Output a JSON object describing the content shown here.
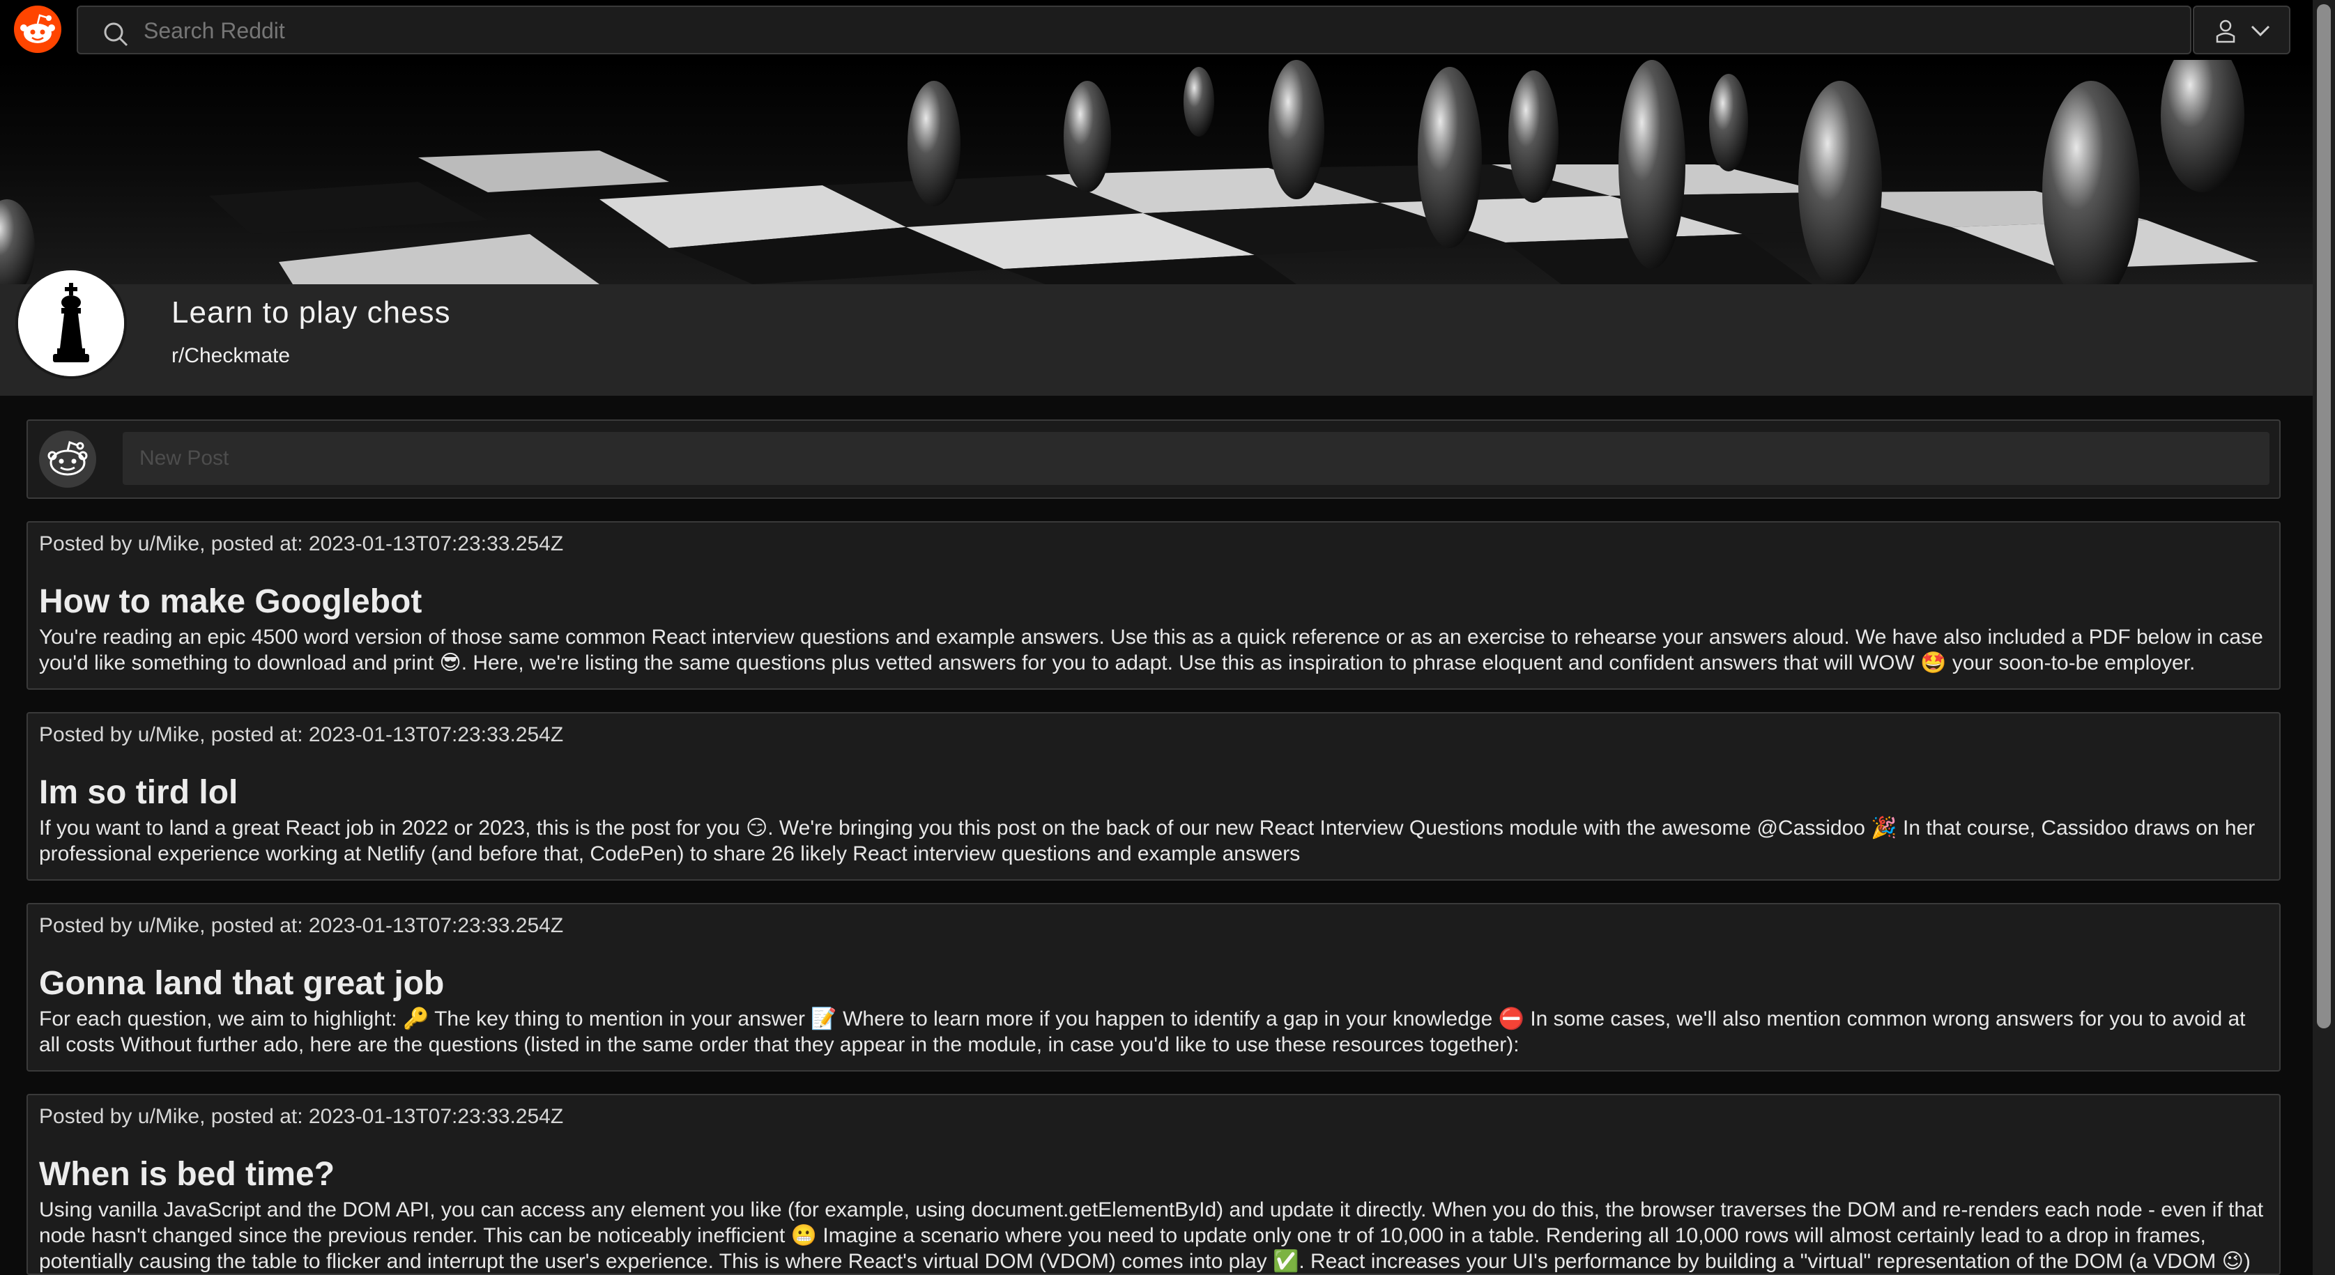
{
  "search": {
    "placeholder": "Search Reddit"
  },
  "icons": {
    "logo": "reddit-logo-icon",
    "search": "search-icon",
    "user": "user-icon",
    "chevron": "chevron-down-icon",
    "avatar": "chess-king-icon",
    "create_avatar": "reddit-snoo-icon"
  },
  "colors": {
    "brand": "#ff4500",
    "background": "#0b0b0b",
    "card": "#1c1c1c"
  },
  "community": {
    "title": "Learn to play chess",
    "name": "r/Checkmate"
  },
  "create_post": {
    "placeholder": "New Post"
  },
  "posts": [
    {
      "meta": "Posted by u/Mike, posted at: 2023-01-13T07:23:33.254Z",
      "title": "How to make Googlebot",
      "body": "You're reading an epic 4500 word version of those same common React interview questions and example answers. Use this as a quick reference or as an exercise to rehearse your answers aloud. We have also included a PDF below in case you'd like something to download and print 😎. Here, we're listing the same questions plus vetted answers for you to adapt. Use this as inspiration to phrase eloquent and confident answers that will WOW 🤩 your soon-to-be employer."
    },
    {
      "meta": "Posted by u/Mike, posted at: 2023-01-13T07:23:33.254Z",
      "title": "Im so tird lol",
      "body": "If you want to land a great React job in 2022 or 2023, this is the post for you 😏. We're bringing you this post on the back of our new React Interview Questions module with the awesome @Cassidoo 🎉 In that course, Cassidoo draws on her professional experience working at Netlify (and before that, CodePen) to share 26 likely React interview questions and example answers"
    },
    {
      "meta": "Posted by u/Mike, posted at: 2023-01-13T07:23:33.254Z",
      "title": "Gonna land that great job",
      "body": "For each question, we aim to highlight: 🔑 The key thing to mention in your answer 📝 Where to learn more if you happen to identify a gap in your knowledge ⛔ In some cases, we'll also mention common wrong answers for you to avoid at all costs Without further ado, here are the questions (listed in the same order that they appear in the module, in case you'd like to use these resources together):"
    },
    {
      "meta": "Posted by u/Mike, posted at: 2023-01-13T07:23:33.254Z",
      "title": "When is bed time?",
      "body": "Using vanilla JavaScript and the DOM API, you can access any element you like (for example, using document.getElementById) and update it directly. When you do this, the browser traverses the DOM and re-renders each node - even if that node hasn't changed since the previous render. This can be noticeably inefficient 😬 Imagine a scenario where you need to update only one tr of 10,000 in a table. Rendering all 10,000 rows will almost certainly lead to a drop in frames, potentially causing the table to flicker and interrupt the user's experience. This is where React's virtual DOM (VDOM) comes into play ✅. React increases your UI's performance by building a \"virtual\" representation of the DOM (a VDOM 😉) to"
    }
  ]
}
